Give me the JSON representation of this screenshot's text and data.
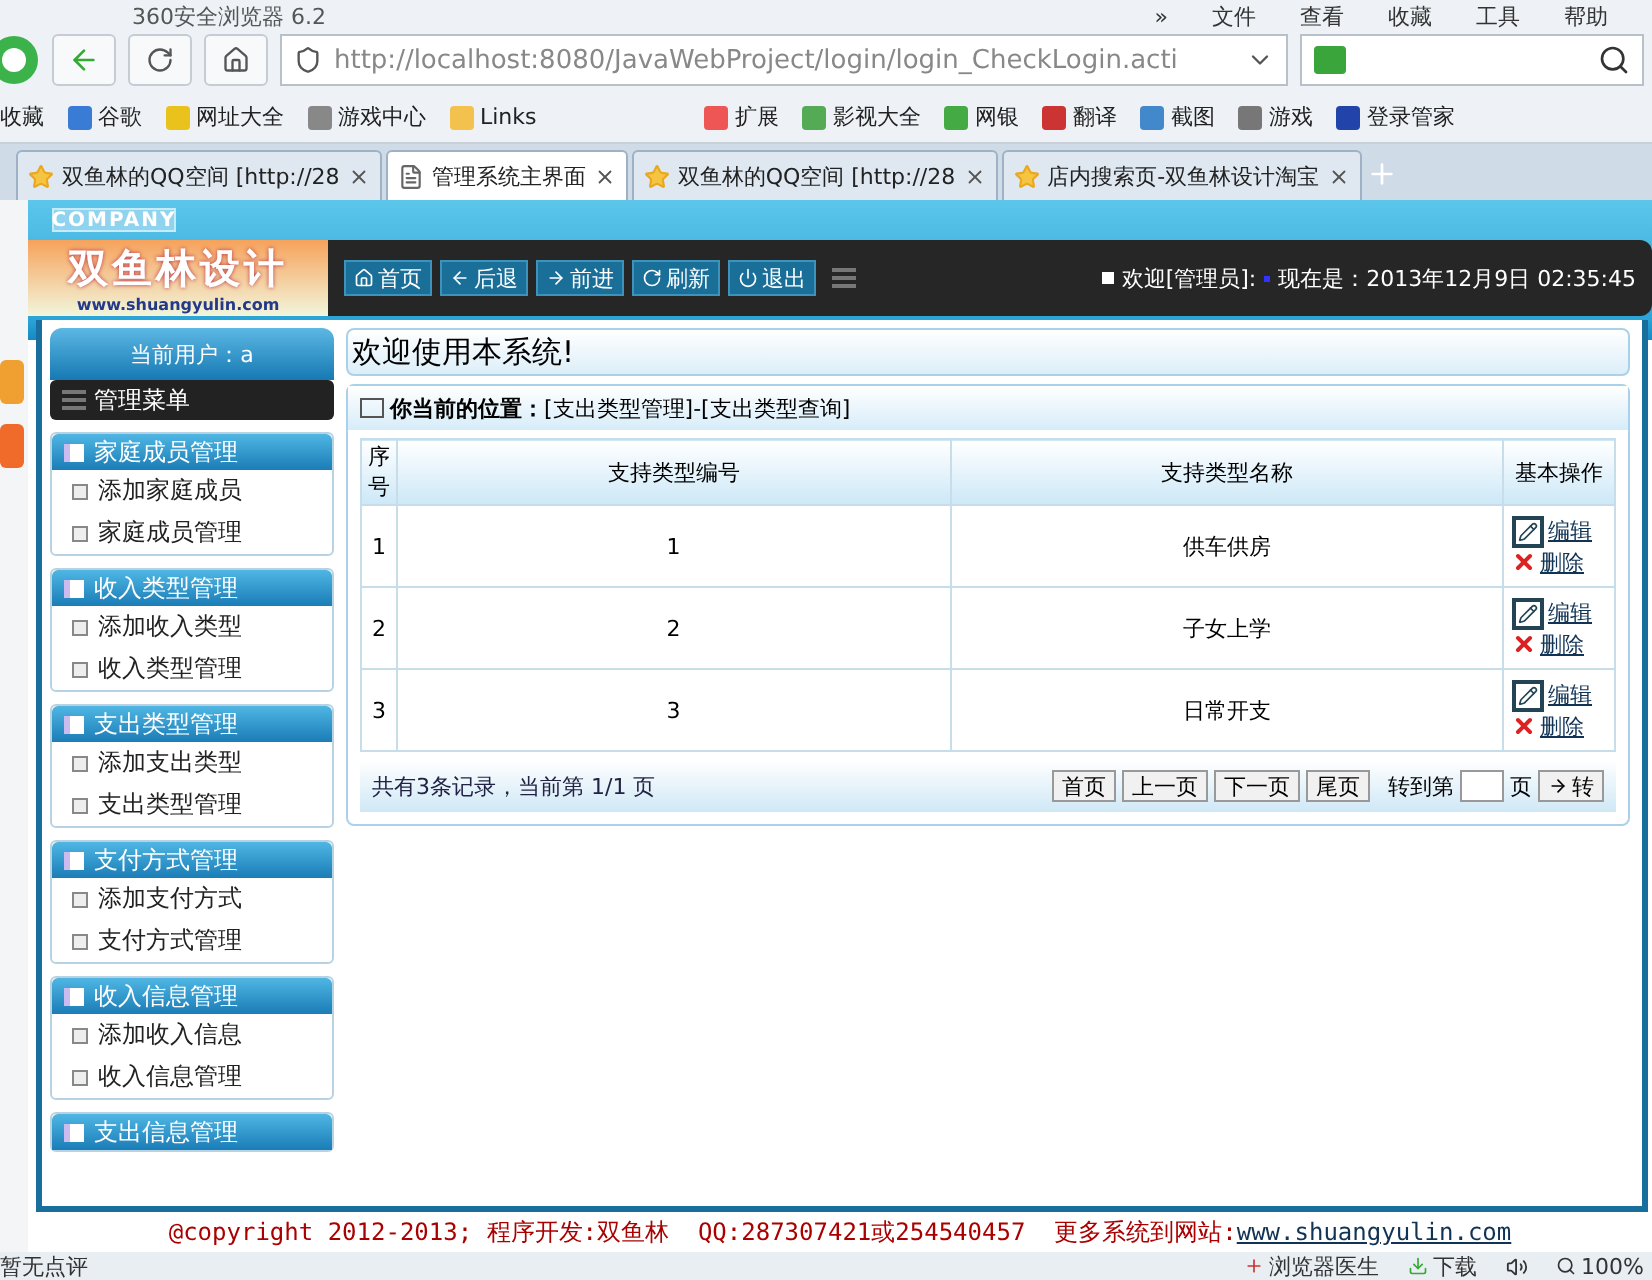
{
  "browser": {
    "title": "360安全浏览器 6.2",
    "overflow": "»",
    "menu": [
      "文件",
      "查看",
      "收藏",
      "工具",
      "帮助"
    ],
    "address": "http://localhost:8080/JavaWebProject/login/login_CheckLogin.acti",
    "bookmarks": [
      "收藏",
      "谷歌",
      "网址大全",
      "游戏中心",
      "Links"
    ],
    "tools": [
      "扩展",
      "影视大全",
      "网银",
      "翻译",
      "截图",
      "游戏",
      "登录管家"
    ],
    "tabs": [
      {
        "label": "双鱼林的QQ空间 [http://28",
        "selected": false
      },
      {
        "label": "管理系统主界面",
        "selected": true
      },
      {
        "label": "双鱼林的QQ空间 [http://28",
        "selected": false
      },
      {
        "label": "店内搜索页-双鱼林设计淘宝",
        "selected": false
      }
    ]
  },
  "header": {
    "badge": "COMPANY",
    "logo_title": "双鱼林设计",
    "logo_url": "www.shuangyulin.com",
    "nav": [
      "首页",
      "后退",
      "前进",
      "刷新",
      "退出"
    ],
    "welcome": "欢迎[管理员]:",
    "clock": "现在是：2013年12月9日 02:35:45"
  },
  "sidebar": {
    "current_user": "当前用户：a",
    "menu_title": "管理菜单",
    "groups": [
      {
        "title": "家庭成员管理",
        "items": [
          "添加家庭成员",
          "家庭成员管理"
        ]
      },
      {
        "title": "收入类型管理",
        "items": [
          "添加收入类型",
          "收入类型管理"
        ]
      },
      {
        "title": "支出类型管理",
        "items": [
          "添加支出类型",
          "支出类型管理"
        ]
      },
      {
        "title": "支付方式管理",
        "items": [
          "添加支付方式",
          "支付方式管理"
        ]
      },
      {
        "title": "收入信息管理",
        "items": [
          "添加收入信息",
          "收入信息管理"
        ]
      },
      {
        "title": "支出信息管理"
      }
    ]
  },
  "main": {
    "greeting": "欢迎使用本系统!",
    "location_label": "你当前的位置：",
    "location": "[支出类型管理]-[支出类型查询]",
    "table": {
      "columns": [
        "序号",
        "支持类型编号",
        "支持类型名称",
        "基本操作"
      ],
      "rows": [
        {
          "cells": [
            "1",
            "1",
            "供车供房"
          ],
          "actions": [
            "编辑",
            "删除"
          ]
        },
        {
          "cells": [
            "2",
            "2",
            "子女上学"
          ],
          "actions": [
            "编辑",
            "删除"
          ]
        },
        {
          "cells": [
            "3",
            "3",
            "日常开支"
          ],
          "actions": [
            "编辑",
            "删除"
          ]
        }
      ]
    },
    "pager": {
      "summary": "共有3条记录，当前第 1/1 页",
      "buttons": [
        "首页",
        "上一页",
        "下一页",
        "尾页"
      ],
      "goto_label": "转到第",
      "page_unit": "页",
      "go": "转"
    }
  },
  "footer": {
    "text": "@copyright 2012-2013; 程序开发:双鱼林  QQ:287307421或254540457  更多系统到网站:",
    "link": "www.shuangyulin.com"
  },
  "status_bar": {
    "comment": "暂无点评",
    "items": [
      "浏览器医生",
      "下载"
    ],
    "zoom": "100%"
  }
}
